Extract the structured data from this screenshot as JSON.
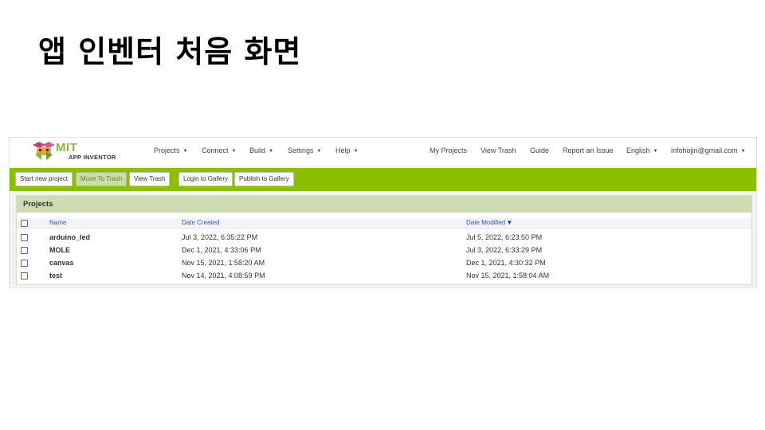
{
  "slide": {
    "title": "앱 인벤터 처음 화면"
  },
  "colors": {
    "toolbar_green": "#8cbf00",
    "panel_header": "#cfdcb2",
    "link_blue": "#3355cc"
  },
  "topbar": {
    "logo": {
      "mit": "MIT",
      "sub": "APP INVENTOR",
      "icon": "app-inventor-bee-icon"
    },
    "menus": [
      {
        "label": "Projects"
      },
      {
        "label": "Connect"
      },
      {
        "label": "Build"
      },
      {
        "label": "Settings"
      },
      {
        "label": "Help"
      }
    ],
    "right_links": {
      "my_projects": "My Projects",
      "view_trash": "View Trash",
      "guide": "Guide",
      "report_issue": "Report an Issue",
      "language": "English",
      "account": "infohojin@gmail.com"
    }
  },
  "toolbar": {
    "start_new": "Start new project",
    "move_trash": "Move To Trash",
    "view_trash": "View Trash",
    "login_gallery": "Login to Gallery",
    "publish_gallery": "Publish to Gallery"
  },
  "projects": {
    "title": "Projects",
    "columns": {
      "name": "Name",
      "created": "Date Created",
      "modified": "Date Modified",
      "sort_icon": "sort-desc-icon"
    },
    "rows": [
      {
        "name": "arduino_led",
        "created": "Jul 3, 2022, 6:35:22 PM",
        "modified": "Jul 5, 2022, 6:23:50 PM"
      },
      {
        "name": "MOLE",
        "created": "Dec 1, 2021, 4:33:06 PM",
        "modified": "Jul 3, 2022, 6:33:29 PM"
      },
      {
        "name": "canvas",
        "created": "Nov 15, 2021, 1:58:20 AM",
        "modified": "Dec 1, 2021, 4:30:32 PM"
      },
      {
        "name": "test",
        "created": "Nov 14, 2021, 4:08:59 PM",
        "modified": "Nov 15, 2021, 1:58:04 AM"
      }
    ]
  }
}
